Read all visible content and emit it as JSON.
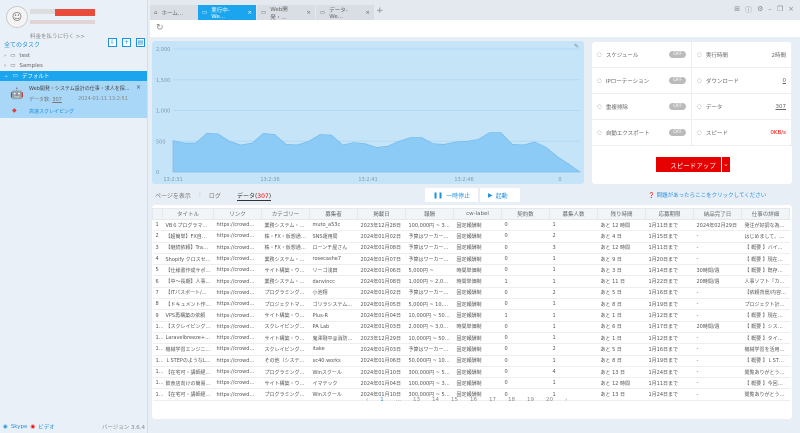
{
  "sidebar": {
    "pay_link": "料金を払うに行く >>",
    "all_tasks": "全てのタスク",
    "folders": [
      "test",
      "Samples",
      "デフォルト"
    ],
    "task": {
      "title": "Web開発・システム設計の仕事・求人を探...",
      "data_label": "データ数:",
      "data_count": "307",
      "timestamp": "2024-01-11 13:2:51",
      "mode": "高速スクレイピング"
    },
    "footer": {
      "skype": "Skype",
      "video": "ビデオ",
      "version": "バージョン 3.6.4"
    }
  },
  "tabs": [
    {
      "label": "ホーム...",
      "icon": "home-icon"
    },
    {
      "label": "実行中-We...",
      "active": true
    },
    {
      "label": "Web開発・..."
    },
    {
      "label": "データ-We..."
    }
  ],
  "chart_data": {
    "type": "area",
    "yticks": [
      "0",
      "500",
      "1,000",
      "1,500",
      "2,000"
    ],
    "ylim": [
      0,
      2000
    ],
    "xticks": [
      "13:2:31",
      "13:2:36",
      "13:2:41",
      "13:2:46",
      "0"
    ],
    "values": [
      510,
      470,
      470,
      630,
      620,
      500,
      440,
      470,
      630,
      610,
      450,
      440,
      500,
      610,
      600,
      440,
      480,
      460,
      400,
      420,
      500,
      560,
      560,
      460,
      450,
      490,
      500,
      530,
      640,
      640,
      450,
      440,
      490,
      400,
      250,
      130,
      0
    ],
    "color": "#8ccbf5"
  },
  "stats": [
    {
      "label": "スケジュール",
      "toggle": "OFF",
      "icon": "alarm-clock-icon"
    },
    {
      "label": "実行時間",
      "value": "2時間",
      "icon": "clock-icon"
    },
    {
      "label": "IPローテーション",
      "toggle": "OFF",
      "icon": "globe-icon"
    },
    {
      "label": "ダウンロード",
      "value": "0",
      "icon": "download-icon"
    },
    {
      "label": "重複排除",
      "toggle": "OFF",
      "icon": "dedupe-icon"
    },
    {
      "label": "データ",
      "value": "307",
      "icon": "chart-icon"
    },
    {
      "label": "自動エクスポート",
      "toggle": "OFF",
      "icon": "export-icon"
    },
    {
      "label": "スピード",
      "value": "0KB/s",
      "icon": "gauge-icon"
    }
  ],
  "speed_up": "スピードアップ",
  "help": "問題があったらここをクリックしてください",
  "subtabs": {
    "page": "ページを表示",
    "log": "ログ",
    "data": "データ(",
    "count": "307",
    "close": ")"
  },
  "controls": {
    "pause": "一時停止",
    "start": "起動"
  },
  "table": {
    "headers": [
      "",
      "タイトル",
      "リンク",
      "カテゴリー",
      "募集者",
      "掲載日",
      "報酬",
      "cw-label",
      "契約数",
      "募集人数",
      "残り時間",
      "応募期限",
      "納品完了日",
      "仕事の詳細"
    ],
    "rows": [
      [
        "1",
        "VB６プログラマ募...",
        "https://crowdwork...",
        "業務システム・ソ...",
        "muto_a53c",
        "2023年12月28日",
        "100,000円 ~ 300...",
        "固定報酬制",
        "0",
        "1",
        "あと 12 時間",
        "1月11日まで",
        "2024年02月29日",
        "発注が好調な為、..."
      ],
      [
        "2",
        "【超簡単】FX自動...",
        "https://crowdwork...",
        "株・FX・仮想通貨...",
        "SNS運用局",
        "2024年01月02日",
        "予算はワーカーと...",
        "固定報酬制",
        "0",
        "2",
        "あと 4 日",
        "1月15日まで",
        "-",
        "はじめまして、こ..."
      ],
      [
        "3",
        "【継続依頼】Trad...",
        "https://crowdwork...",
        "株・FX・仮想通貨...",
        "ローンチ屋さん",
        "2024年01月08日",
        "予算はワーカーと...",
        "固定報酬制",
        "0",
        "3",
        "あと 12 時間",
        "1月11日まで",
        "-",
        "【 概要 】バイナリ..."
      ],
      [
        "4",
        "Shopify クロスセ...",
        "https://crowdwork...",
        "業務システム・ソ...",
        "rosecashe7",
        "2024年01月07日",
        "予算はワーカーと...",
        "固定報酬制",
        "0",
        "1",
        "あと 9 日",
        "1月20日まで",
        "-",
        "【 概要 】現在、s..."
      ],
      [
        "5",
        "【仕様書作成サポ...",
        "https://crowdwork...",
        "サイト構築・ウェ...",
        "リーゴ浅田",
        "2024年01月06日",
        "5,000円 ~",
        "時間単価制",
        "0",
        "1",
        "あと 3 日",
        "1月14日まで",
        "30時間/週",
        "【 概要 】既存シ..."
      ],
      [
        "6",
        "【中～長期】人事...",
        "https://crowdwork...",
        "業務システム・ソ...",
        "danvincc",
        "2024年01月08日",
        "1,000円 ~ 2,000円",
        "時間単価制",
        "1",
        "1",
        "あと 11 日",
        "1月22日まで",
        "20時間/週",
        "人事ソフト「カオ..."
      ],
      [
        "7",
        "【ITパスポート/...",
        "https://crowdwork...",
        "プログラミング講...",
        "小池翔",
        "2024年01月02日",
        "予算はワーカーと...",
        "固定報酬制",
        "0",
        "2",
        "あと 5 日",
        "1月16日まで",
        "-",
        "【依頼背景/内容..."
      ],
      [
        "8",
        "【ドキュメント作...",
        "https://crowdwork...",
        "プロジェクトマネ...",
        "ゴリラシステムデ...",
        "2024年01月05日",
        "5,000円 ~ 10,000...",
        "固定報酬制",
        "0",
        "1",
        "あと 8 日",
        "1月19日まで",
        "-",
        "プロジェクト計画..."
      ],
      [
        "9",
        "VPS再構築の依頼",
        "https://crowdwork...",
        "サイト構築・ウェ...",
        "Plus-R",
        "2024年01月04日",
        "10,000円 ~ 50,00...",
        "固定報酬制",
        "1",
        "1",
        "あと 1 日",
        "1月12日まで",
        "-",
        "【 概要 】現在ホく..."
      ],
      [
        "10",
        "【スクレイピング...",
        "https://crowdwork...",
        "スクレイピング・...",
        "PA Lab",
        "2024年01月03日",
        "2,000円 ~ 3,000円",
        "時間単価制",
        "0",
        "1",
        "あと 6 日",
        "1月17日まで",
        "20時間/週",
        "【 概要 】システム..."
      ],
      [
        "11",
        "Laravelbreeze+pa...",
        "https://crowdwork...",
        "サイト構築・ウェ...",
        "鬼澤剛平@消防時...",
        "2023年12月29日",
        "10,000円 ~ 50,00...",
        "固定報酬制",
        "0",
        "1",
        "あと 1 日",
        "1月12日まで",
        "-",
        "【 概要 】タイト..."
      ],
      [
        "12",
        "機械学習エンジニ...",
        "https://crowdwork...",
        "スクレイピング・...",
        "itake",
        "2024年01月03日",
        "予算はワーカーと...",
        "固定報酬制",
        "0",
        "2",
        "あと 5 日",
        "1月16日まで",
        "-",
        "機械学習を活用し..."
      ],
      [
        "13",
        "ＬSTEPのようなL...",
        "https://crowdwork...",
        "その他（システム...",
        "xc40.works",
        "2024年01月06日",
        "50,000円 ~ 100,0...",
        "固定報酬制",
        "0",
        "1",
        "あと 8 日",
        "1月19日まで",
        "-",
        "【 概要 】ＬSTEP..."
      ],
      [
        "14",
        "【在宅可・講師経...",
        "https://crowdwork...",
        "プログラミング講...",
        "Winスクール",
        "2024年01月10日",
        "300,000円 ~ 500...",
        "固定報酬制",
        "0",
        "4",
        "あと 13 日",
        "1月24日まで",
        "-",
        "閲覧ありがとうご..."
      ],
      [
        "15",
        "飲食店向けの簡易...",
        "https://crowdwork...",
        "サイト構築・ウェ...",
        "イマテック",
        "2024年01月04日",
        "100,000円 ~ 300...",
        "固定報酬制",
        "0",
        "1",
        "あと 12 時間",
        "1月11日まで",
        "-",
        "【 概要 】今回、飲..."
      ],
      [
        "16",
        "【在宅可・講師経...",
        "https://crowdwork...",
        "プログラミング講...",
        "Winスクール",
        "2024年01月10日",
        "300,000円 ~ 500...",
        "固定報酬制",
        "0",
        "1",
        "あと 13 日",
        "1月24日まで",
        "-",
        "閲覧ありがとうご..."
      ]
    ]
  },
  "pager": {
    "prev": "‹",
    "pages": [
      "1",
      "...",
      "13",
      "14",
      "15",
      "16",
      "17",
      "18",
      "19",
      "20"
    ],
    "current": "1",
    "next": "›"
  }
}
